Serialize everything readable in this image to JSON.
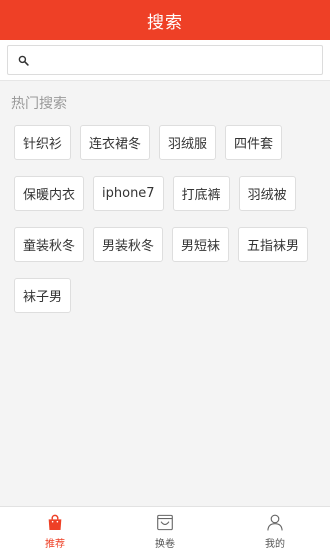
{
  "header": {
    "title": "搜索"
  },
  "search": {
    "value": "",
    "placeholder": ""
  },
  "hot": {
    "title": "热门搜索",
    "rows": [
      [
        "针织衫",
        "连衣裙冬",
        "羽绒服",
        "四件套"
      ],
      [
        "保暖内衣",
        "iphone7",
        "打底裤",
        "羽绒被"
      ],
      [
        "童装秋冬",
        "男装秋冬",
        "男短袜",
        "五指袜男"
      ],
      [
        "袜子男"
      ]
    ]
  },
  "tabbar": {
    "items": [
      {
        "label": "推荐",
        "icon": "shopping-bag-icon",
        "active": true
      },
      {
        "label": "换卷",
        "icon": "basket-icon",
        "active": false
      },
      {
        "label": "我的",
        "icon": "user-icon",
        "active": false
      }
    ]
  },
  "colors": {
    "accent": "#ee4026",
    "tag_border": "#dedede",
    "section_title": "#9a9a9a"
  }
}
